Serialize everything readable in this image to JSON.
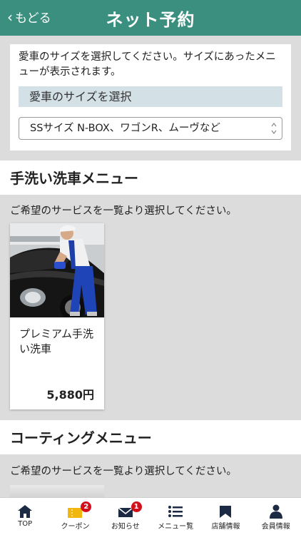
{
  "header": {
    "back_label": "もどる",
    "back_chevron": "‹",
    "title": "ネット予約",
    "bg_color": "#3a8f7f"
  },
  "size_selector": {
    "description": "愛車のサイズを選択してください。サイズにあったメニューが表示されます。",
    "heading": "愛車のサイズを選択",
    "selected_value": "SSサイズ N-BOX、ワゴンR、ムーヴなど"
  },
  "sections": [
    {
      "title": "手洗い洗車メニュー",
      "description": "ご希望のサービスを一覧より選択してください。",
      "items": [
        {
          "name": "プレミアム手洗い洗車",
          "price": "5,880円"
        }
      ]
    },
    {
      "title": "コーティングメニュー",
      "description": "ご希望のサービスを一覧より選択してください。"
    }
  ],
  "tabbar": [
    {
      "label": "TOP",
      "icon": "home-icon"
    },
    {
      "label": "クーポン",
      "icon": "coupon-icon",
      "badge": "2"
    },
    {
      "label": "お知らせ",
      "icon": "mail-icon",
      "badge": "1"
    },
    {
      "label": "メニュー覧",
      "icon": "menu-list-icon"
    },
    {
      "label": "店舗情報",
      "icon": "store-icon"
    },
    {
      "label": "会員情報",
      "icon": "person-icon"
    }
  ],
  "colors": {
    "accent": "#3a8f7f",
    "badge": "#d40f1c",
    "coupon_icon": "#f2b70f"
  }
}
